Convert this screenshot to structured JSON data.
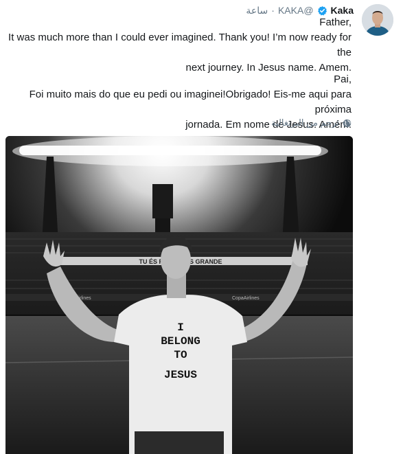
{
  "tweet": {
    "author_name": "Kaka",
    "verified": true,
    "handle": "@KAKA",
    "separator": "·",
    "timestamp": "ساعة",
    "english_lines": [
      "Father,",
      "It was much more than I could ever imagined. Thank you! I’m now ready for the",
      "next journey. In Jesus name. Amem."
    ],
    "portuguese_lines": [
      "Pai,",
      "Foi muito mais do que eu pedi ou imaginei!Obrigado! Eis-me aqui para próxima",
      "jornada. Em nome de Jesus. Amém."
    ],
    "translate_label": "ترجم من البرتغالية",
    "photo": {
      "banner_text": "TU ÉS FORTE · ÉS GRANDE",
      "sponsor_text": "CopaAirlines",
      "shirt_lines": [
        "I",
        "BELONG",
        "TO",
        "JESUS"
      ]
    }
  },
  "colors": {
    "text": "#14171a",
    "secondary": "#657786",
    "verified": "#1da1f2"
  },
  "icons": {
    "verified": "verified-badge-icon",
    "translate": "globe-icon"
  }
}
